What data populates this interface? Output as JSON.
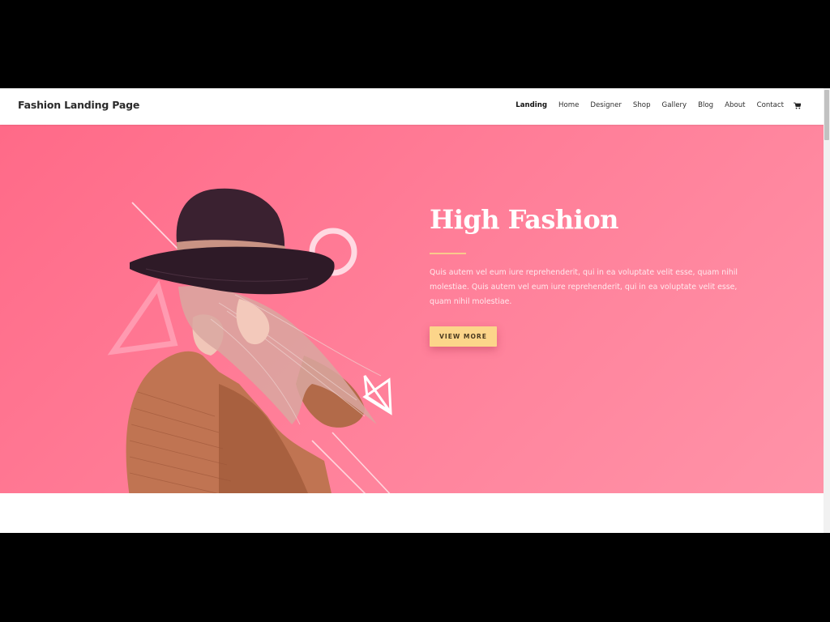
{
  "header": {
    "logo": "Fashion Landing Page",
    "nav": [
      {
        "label": "Landing",
        "active": true
      },
      {
        "label": "Home"
      },
      {
        "label": "Designer"
      },
      {
        "label": "Shop"
      },
      {
        "label": "Gallery"
      },
      {
        "label": "Blog"
      },
      {
        "label": "About"
      },
      {
        "label": "Contact"
      }
    ],
    "cart_icon": "shopping-cart-icon"
  },
  "hero": {
    "title": "High Fashion",
    "body": "Quis autem vel eum iure reprehenderit, qui in ea voluptate velit esse, quam nihil molestiae. Quis autem vel eum iure reprehenderit, qui in ea voluptate velit esse, quam nihil molestiae.",
    "cta_label": "VIEW MORE",
    "image_alt": "Woman in wide-brim hat and brown knit sweater",
    "colors": {
      "gradient_start": "#ff6a88",
      "gradient_end": "#ff93a8",
      "accent_divider": "#f9c98c",
      "button": "#fcd58a"
    }
  }
}
